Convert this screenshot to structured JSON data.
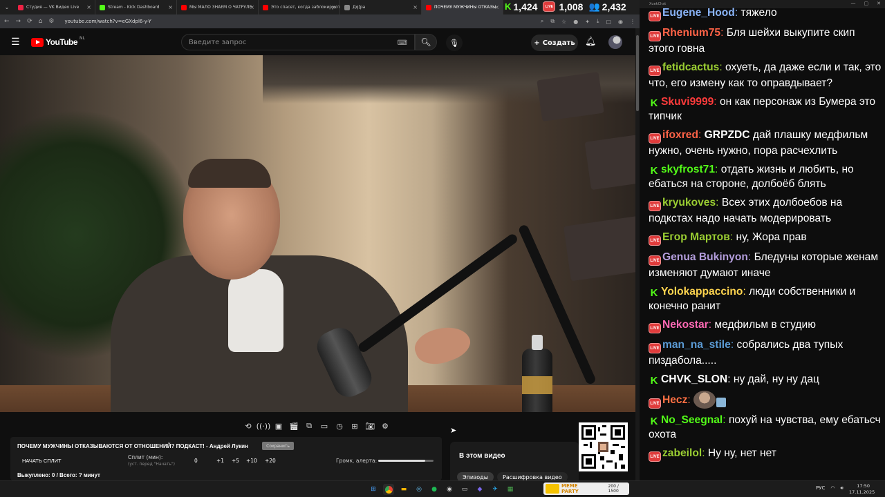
{
  "browser": {
    "tabs": [
      {
        "label": "Студия — VK Видео Live",
        "color": "#e24",
        "active": false
      },
      {
        "label": "Stream - Kick Dashboard",
        "color": "#53fc18",
        "active": false
      },
      {
        "label": "МЫ МАЛО ЗНАЕМ О ЧАТРУЛЕ",
        "color": "#ff0000",
        "active": false
      },
      {
        "label": "Это спасет, когда заблокируют",
        "color": "#ff0000",
        "active": false
      },
      {
        "label": "Дq]ра",
        "color": "#888888",
        "active": false
      },
      {
        "label": "ПОЧЕМУ МУЖЧИНЫ ОТКАЗЫ",
        "color": "#ff0000",
        "active": true
      }
    ],
    "url": "youtube.com/watch?v=eGXdpl6-y-Y"
  },
  "counters": {
    "kick": "1,424",
    "vk": "1,008",
    "total": "2,432"
  },
  "youtube": {
    "logo_text": "YouTube",
    "region": "NL",
    "search_placeholder": "Введите запрос",
    "create_label": "Создать"
  },
  "overlay": {
    "title": "ПОЧЕМУ МУЖЧИНЫ ОТКАЗЫВАЮТСЯ ОТ ОТНОШЕНИЙ? ПОДКАСТ! - Андрей Лукин",
    "save_label": "Сохранить",
    "start_split": "НАЧАТЬ СПЛИТ",
    "split_label": "Сплит (мин):",
    "split_hint": "(уст. перед \"Начать\")",
    "split_values": [
      "0",
      "+1",
      "+5",
      "+10",
      "+20"
    ],
    "alert_label": "Громк. алерта:",
    "alert_level": 0.85,
    "footer": "Выкуплено: 0 / Всего: ? минут"
  },
  "in_this_video": {
    "heading": "В этом видео",
    "tab_episodes": "Эпизоды",
    "tab_transcript": "Расшифровка видео"
  },
  "chat": {
    "header": "XuekChat",
    "messages": [
      {
        "platform": "vk",
        "nick": "Eugene_Hood",
        "color": "#8ab4f8",
        "text": "тяжело"
      },
      {
        "platform": "vk",
        "nick": "Rhenium75",
        "color": "#ff6347",
        "text": "Бля шейхи выкупите скип этого говна"
      },
      {
        "platform": "vk",
        "nick": "fetidcactus",
        "color": "#9acd32",
        "text": "охуеть, да даже если и так, это что, его измену как то оправдывает?"
      },
      {
        "platform": "kick",
        "nick": "Skuvi9999",
        "color": "#ff3b3b",
        "text": "он как персонаж из Бумера это типчик"
      },
      {
        "platform": "vk",
        "nick": "ifoxred",
        "color": "#ff6347",
        "bold": "GRPZDC",
        "text": "дай плашку медфильм нужно, очень нужно, пора расчехлить"
      },
      {
        "platform": "kick",
        "nick": "skyfrost71",
        "color": "#53fc18",
        "text": "отдать жизнь и любить, но ебаться на стороне, долбоёб блять"
      },
      {
        "platform": "vk",
        "nick": "kryukoves",
        "color": "#9acd32",
        "text": "Всех этих долбоебов на подкстах надо начать модерировать"
      },
      {
        "platform": "vk",
        "nick": "Егор Мартов",
        "color": "#9acd32",
        "text": "ну, Жора прав"
      },
      {
        "platform": "vk",
        "nick": "Genua Bukinyon",
        "color": "#b39ddb",
        "text": "Бледуны которые женам изменяют думают иначе"
      },
      {
        "platform": "kick",
        "nick": "Yolokappaccino",
        "color": "#ffd54f",
        "text": "люди собственники и конечно ранит"
      },
      {
        "platform": "vk",
        "nick": "Nekostar",
        "color": "#ff69b4",
        "text": "медфильм в студию"
      },
      {
        "platform": "vk",
        "nick": "man_na_stile",
        "color": "#5b9bd5",
        "text": "собрались два тупых пиздабола....."
      },
      {
        "platform": "kick",
        "nick": "CHVK_SLON",
        "color": "#ffffff",
        "text": "ну дай, ну ну дац"
      },
      {
        "platform": "vk",
        "nick": "Hecz",
        "color": "#ff7043",
        "text": "",
        "emote": true
      },
      {
        "platform": "kick",
        "nick": "No_Seegnal",
        "color": "#53fc18",
        "text": "похуй на чувства, ему ебатьсч охота"
      },
      {
        "platform": "vk",
        "nick": "zabeilol",
        "color": "#9acd32",
        "text": "Ну ну, нет нет"
      }
    ]
  },
  "taskbar": {
    "widget_label": "MEME PARTY",
    "widget_value": "200 / 1500",
    "lang": "РУС",
    "time": "17:50",
    "date": "17.11.2025"
  }
}
